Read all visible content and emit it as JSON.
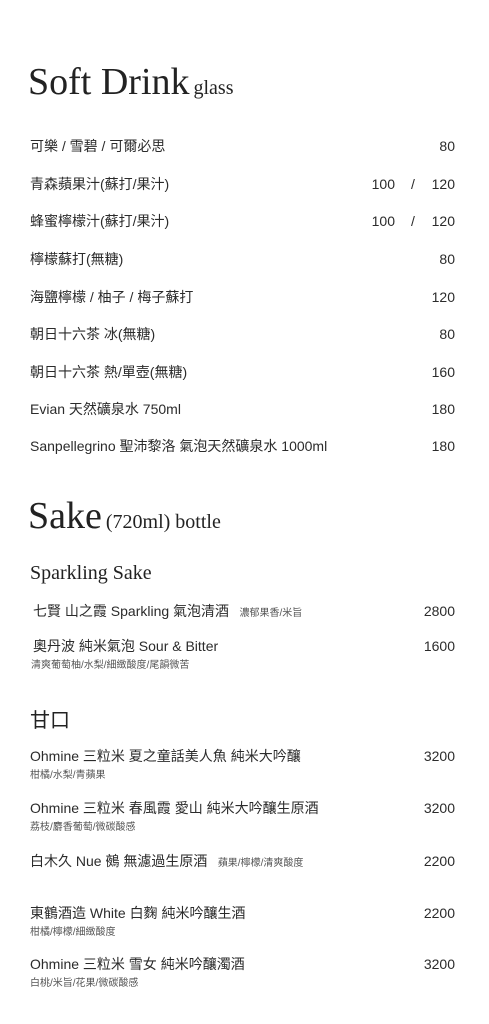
{
  "soft_drink": {
    "title": "Soft Drink",
    "subtitle": "glass",
    "items": [
      {
        "name": "可樂 / 雪碧 / 可爾必思",
        "price": "80"
      },
      {
        "name": "青森蘋果汁(蘇打/果汁)",
        "price_a": "100",
        "sep": "/",
        "price_b": "120"
      },
      {
        "name": "蜂蜜檸檬汁(蘇打/果汁)",
        "price_a": "100",
        "sep": "/",
        "price_b": "120"
      },
      {
        "name": "檸檬蘇打(無糖)",
        "price": "80"
      },
      {
        "name": "海鹽檸檬 / 柚子 / 梅子蘇打",
        "price": "120"
      },
      {
        "name": "朝日十六茶 冰(無糖)",
        "price": "80"
      },
      {
        "name": "朝日十六茶 熱/單壺(無糖)",
        "price": "160"
      },
      {
        "name": "Evian 天然礦泉水 750ml",
        "price": "180"
      },
      {
        "name": "Sanpellegrino 聖沛黎洛 氣泡天然礦泉水 1000ml",
        "price": "180"
      }
    ]
  },
  "sake": {
    "title": "Sake",
    "subtitle": "(720ml) bottle",
    "sparkling": {
      "heading": "Sparkling Sake",
      "items": [
        {
          "name": "七賢 山之霞 Sparkling 氣泡清酒",
          "note": "濃郁果香/米旨",
          "price": "2800"
        },
        {
          "name": "奧丹波 純米氣泡 Sour & Bitter",
          "sub": "清爽葡萄柚/水梨/細緻酸度/尾韻微苦",
          "price": "1600"
        }
      ]
    },
    "sweet": {
      "heading": "甘口",
      "items": [
        {
          "name": "Ohmine 三粒米 夏之童話美人魚 純米大吟釀",
          "sub": "柑橘/水梨/青蘋果",
          "price": "3200"
        },
        {
          "name": "Ohmine 三粒米 春風霞 愛山 純米大吟釀生原酒",
          "sub": "荔枝/麝香葡萄/微碳酸感",
          "price": "3200"
        },
        {
          "name": "白木久 Nue 鵺 無濾過生原酒",
          "note": "蘋果/檸檬/清爽酸度",
          "price": "2200"
        },
        {
          "name": "東鶴酒造 White 白麴 純米吟釀生酒",
          "sub": "柑橘/檸檬/細緻酸度",
          "price": "2200"
        },
        {
          "name": "Ohmine 三粒米 雪女 純米吟釀濁酒",
          "sub": "白桃/米旨/花果/微碳酸感",
          "price": "3200"
        }
      ]
    }
  }
}
